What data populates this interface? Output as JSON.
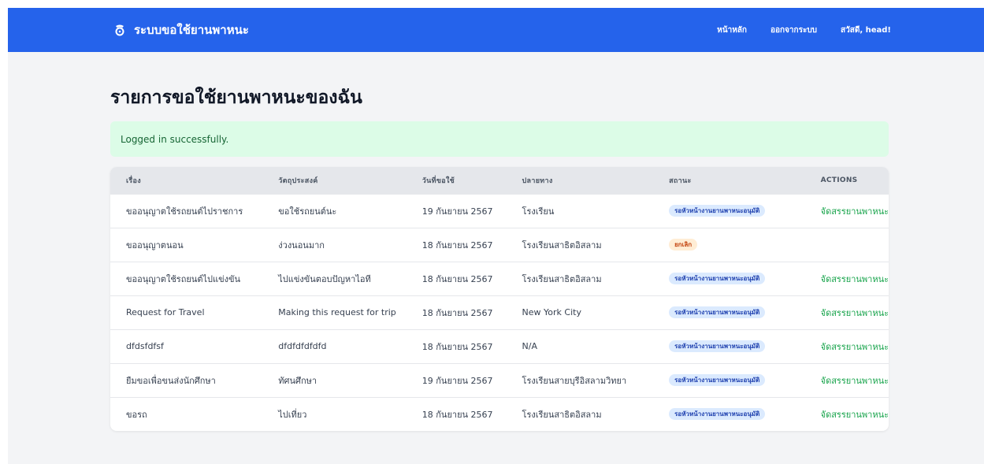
{
  "navbar": {
    "brand": "ระบบขอใช้ยานพาหนะ",
    "brand_icon": "car-icon",
    "links": {
      "home": "หน้าหลัก",
      "logout": "ออกจากระบบ",
      "greeting": "สวัสดี, head!"
    },
    "color": "#2563eb"
  },
  "page": {
    "title": "รายการขอใช้ยานพาหนะของฉัน"
  },
  "alert": {
    "message": "Logged in successfully.",
    "color": "#dcfce7"
  },
  "table": {
    "headers": [
      "เรื่อง",
      "วัตถุประสงค์",
      "วันที่ขอใช้",
      "ปลายทาง",
      "สถานะ",
      "ACTIONS"
    ],
    "rows": [
      {
        "subject": "ขออนุญาตใช้รถยนต์ไปราชการ",
        "purpose": "ขอใช้รถยนต์นะ",
        "date": "19 กันยายน 2567",
        "destination": "โรงเรียน",
        "status": "รอหัวหน้างานยานพาหนะอนุมัติ",
        "status_type": "pending",
        "action": "จัดสรรยานพาหนะ"
      },
      {
        "subject": "ขออนุญาตนอน",
        "purpose": "ง่วงนอนมาก",
        "date": "18 กันยายน 2567",
        "destination": "โรงเรียนสาธิตอิสลาม",
        "status": "ยกเลิก",
        "status_type": "cancel",
        "action": ""
      },
      {
        "subject": "ขออนุญาตใช้รถยนต์ไปแข่งขัน",
        "purpose": "ไปแข่งขันตอบปัญหาไอที",
        "date": "18 กันยายน 2567",
        "destination": "โรงเรียนสาธิตอิสลาม",
        "status": "รอหัวหน้างานยานพาหนะอนุมัติ",
        "status_type": "pending",
        "action": "จัดสรรยานพาหนะ"
      },
      {
        "subject": "Request for Travel",
        "purpose": "Making this request for trip",
        "date": "18 กันยายน 2567",
        "destination": "New York City",
        "status": "รอหัวหน้างานยานพาหนะอนุมัติ",
        "status_type": "pending",
        "action": "จัดสรรยานพาหนะ"
      },
      {
        "subject": "dfdsfdfsf",
        "purpose": "dfdfdfdfdfd",
        "date": "18 กันยายน 2567",
        "destination": "N/A",
        "status": "รอหัวหน้างานยานพาหนะอนุมัติ",
        "status_type": "pending",
        "action": "จัดสรรยานพาหนะ"
      },
      {
        "subject": "ยืมขอเพื่อขนส่งนักศึกษา",
        "purpose": "ทัศนศึกษา",
        "date": "19 กันยายน 2567",
        "destination": "โรงเรียนสายบุรีอิสลามวิทยา",
        "status": "รอหัวหน้างานยานพาหนะอนุมัติ",
        "status_type": "pending",
        "action": "จัดสรรยานพาหนะ"
      },
      {
        "subject": "ขอรถ",
        "purpose": "ไปเที่ยว",
        "date": "18 กันยายน 2567",
        "destination": "โรงเรียนสาธิตอิสลาม",
        "status": "รอหัวหน้างานยานพาหนะอนุมัติ",
        "status_type": "pending",
        "action": "จัดสรรยานพาหนะ"
      }
    ]
  }
}
